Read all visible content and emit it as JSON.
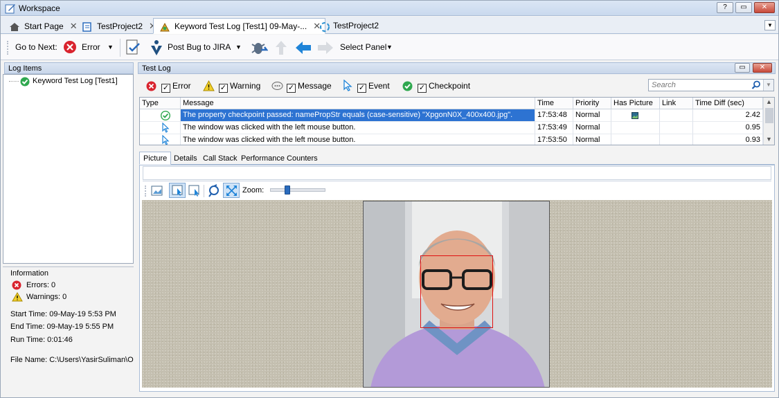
{
  "window": {
    "title": "Workspace",
    "help": "?"
  },
  "tabs": [
    {
      "label": "Start Page"
    },
    {
      "label": "TestProject2"
    },
    {
      "label": "Keyword Test Log [Test1] 09-May-..."
    },
    {
      "label": "TestProject2"
    }
  ],
  "toolbar": {
    "go_to_next": "Go to Next:",
    "error": "Error",
    "post_bug": "Post Bug to JIRA",
    "select_panel": "Select Panel"
  },
  "left": {
    "log_items_title": "Log Items",
    "tree_item": "Keyword Test Log [Test1]",
    "info_title": "Information",
    "errors": "Errors: 0",
    "warnings": "Warnings: 0",
    "start_time": "Start Time: 09-May-19 5:53 PM",
    "end_time": "End Time: 09-May-19 5:55 PM",
    "run_time": "Run Time: 0:01:46",
    "file_name": "File Name: C:\\Users\\YasirSuliman\\O"
  },
  "testlog": {
    "title": "Test Log",
    "filters": [
      "Error",
      "Warning",
      "Message",
      "Event",
      "Checkpoint"
    ],
    "search_placeholder": "Search",
    "columns": [
      "Type",
      "Message",
      "Time",
      "Priority",
      "Has Picture",
      "Link",
      "Time Diff (sec)"
    ],
    "rows": [
      {
        "message": "The property checkpoint passed: namePropStr equals (case-sensitive) \"XpgonN0X_400x400.jpg\".",
        "time": "17:53:48",
        "priority": "Normal",
        "diff": "2.42"
      },
      {
        "message": "The window was clicked with the left mouse button.",
        "time": "17:53:49",
        "priority": "Normal",
        "diff": "0.95"
      },
      {
        "message": "The window was clicked with the left mouse button.",
        "time": "17:53:50",
        "priority": "Normal",
        "diff": "0.93"
      }
    ]
  },
  "subtabs": [
    "Picture",
    "Details",
    "Call Stack",
    "Performance Counters"
  ],
  "picture": {
    "zoom_label": "Zoom:",
    "zoom_level": 0.28
  }
}
